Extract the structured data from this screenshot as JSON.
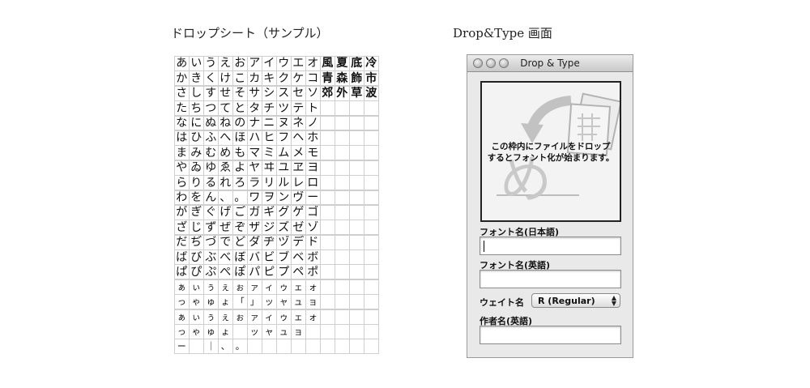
{
  "captions": {
    "sheet": "ドロップシート（サンプル）",
    "window": "Drop&Type 画面"
  },
  "sheet": {
    "rows": [
      [
        "あ",
        "い",
        "う",
        "え",
        "お",
        "ア",
        "イ",
        "ウ",
        "エ",
        "オ",
        "風",
        "夏",
        "底",
        "冷"
      ],
      [
        "か",
        "き",
        "く",
        "け",
        "こ",
        "カ",
        "キ",
        "ク",
        "ケ",
        "コ",
        "青",
        "森",
        "飾",
        "市"
      ],
      [
        "さ",
        "し",
        "す",
        "せ",
        "そ",
        "サ",
        "シ",
        "ス",
        "セ",
        "ソ",
        "郊",
        "外",
        "草",
        "波"
      ],
      [
        "た",
        "ち",
        "つ",
        "て",
        "と",
        "タ",
        "チ",
        "ツ",
        "テ",
        "ト",
        "",
        "",
        "",
        ""
      ],
      [
        "な",
        "に",
        "ぬ",
        "ね",
        "の",
        "ナ",
        "ニ",
        "ヌ",
        "ネ",
        "ノ",
        "",
        "",
        "",
        ""
      ],
      [
        "は",
        "ひ",
        "ふ",
        "へ",
        "ほ",
        "ハ",
        "ヒ",
        "フ",
        "ヘ",
        "ホ",
        "",
        "",
        "",
        ""
      ],
      [
        "ま",
        "み",
        "む",
        "め",
        "も",
        "マ",
        "ミ",
        "ム",
        "メ",
        "モ",
        "",
        "",
        "",
        ""
      ],
      [
        "や",
        "ゐ",
        "ゆ",
        "ゑ",
        "よ",
        "ヤ",
        "ヰ",
        "ユ",
        "ヱ",
        "ヨ",
        "",
        "",
        "",
        ""
      ],
      [
        "ら",
        "り",
        "る",
        "れ",
        "ろ",
        "ラ",
        "リ",
        "ル",
        "レ",
        "ロ",
        "",
        "",
        "",
        ""
      ],
      [
        "わ",
        "を",
        "ん",
        "、",
        "。",
        "ワ",
        "ヲ",
        "ン",
        "ヴ",
        "ー",
        "",
        "",
        "",
        ""
      ],
      [
        "が",
        "ぎ",
        "ぐ",
        "げ",
        "ご",
        "ガ",
        "ギ",
        "グ",
        "ゲ",
        "ゴ",
        "",
        "",
        "",
        ""
      ],
      [
        "ざ",
        "じ",
        "ず",
        "ぜ",
        "ぞ",
        "ザ",
        "ジ",
        "ズ",
        "ゼ",
        "ゾ",
        "",
        "",
        "",
        ""
      ],
      [
        "だ",
        "ぢ",
        "づ",
        "で",
        "ど",
        "ダ",
        "ヂ",
        "ヅ",
        "デ",
        "ド",
        "",
        "",
        "",
        ""
      ],
      [
        "ば",
        "び",
        "ぶ",
        "べ",
        "ぼ",
        "バ",
        "ビ",
        "ブ",
        "ベ",
        "ボ",
        "",
        "",
        "",
        ""
      ],
      [
        "ぱ",
        "ぴ",
        "ぷ",
        "ぺ",
        "ぽ",
        "パ",
        "ピ",
        "プ",
        "ペ",
        "ポ",
        "",
        "",
        "",
        ""
      ],
      [
        "ぁ",
        "ぃ",
        "ぅ",
        "ぇ",
        "ぉ",
        "ァ",
        "ィ",
        "ゥ",
        "ェ",
        "ォ",
        "",
        "",
        "",
        ""
      ],
      [
        "っ",
        "ゃ",
        "ゅ",
        "ょ",
        "「",
        "」",
        "ッ",
        "ャ",
        "ュ",
        "ョ",
        "",
        "",
        "",
        ""
      ],
      [
        "ぁ",
        "ぃ",
        "ぅ",
        "ぇ",
        "ぉ",
        "ァ",
        "ィ",
        "ゥ",
        "ェ",
        "ォ",
        "",
        "",
        "",
        ""
      ],
      [
        "っ",
        "ゃ",
        "ゅ",
        "ょ",
        "",
        "ッ",
        "ャ",
        "ュ",
        "ョ",
        "",
        "",
        "",
        "",
        ""
      ],
      [
        "ー",
        "",
        "｜",
        "、",
        "。",
        "",
        "",
        "",
        "",
        "",
        "",
        "",
        "",
        ""
      ]
    ]
  },
  "window": {
    "title": "Drop & Type",
    "drop_message_line1": "この枠内にファイルをドロップ",
    "drop_message_line2": "するとフォント化が始まります。",
    "drop_glyph": "め",
    "font_name_jp_label": "フォント名(日本語)",
    "font_name_jp_value": "",
    "font_name_en_label": "フォント名(英語)",
    "font_name_en_value": "",
    "weight_label": "ウェイト名",
    "weight_value": "R (Regular)",
    "author_label": "作者名(英語)",
    "author_value": ""
  }
}
